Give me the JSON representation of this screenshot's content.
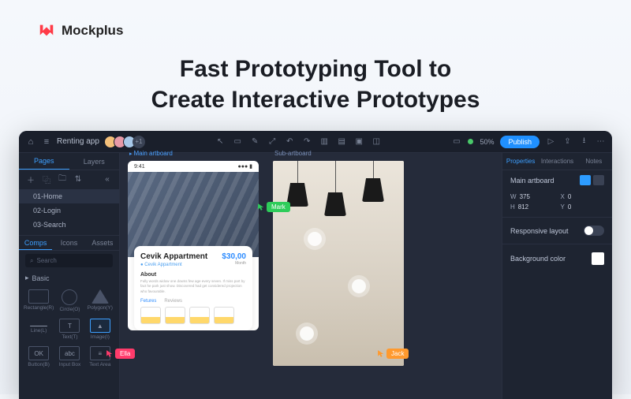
{
  "brand": {
    "name": "Mockplus"
  },
  "hero": {
    "line1": "Fast Prototyping Tool to",
    "line2": "Create Interactive Prototypes"
  },
  "topbar": {
    "project": "Renting app",
    "zoom": "50%",
    "publish": "Publish",
    "avatars_more": "+1"
  },
  "left": {
    "tabs": {
      "pages": "Pages",
      "layers": "Layers"
    },
    "pages": [
      "01-Home",
      "02-Login",
      "03-Search"
    ],
    "asset_tabs": {
      "comps": "Comps",
      "icons": "Icons",
      "assets": "Assets"
    },
    "search": "Search",
    "group": "Basic",
    "components": [
      {
        "label": "Rectangle(R)"
      },
      {
        "label": "Circle(O)"
      },
      {
        "label": "Polygon(Y)"
      },
      {
        "label": "Line(L)"
      },
      {
        "label": "Text(T)",
        "glyph": "T"
      },
      {
        "label": "Image(I)"
      },
      {
        "label": "Button(B)",
        "glyph": "OK"
      },
      {
        "label": "Input Box",
        "glyph": "abc"
      },
      {
        "label": "Text Area",
        "glyph": "≡"
      }
    ]
  },
  "canvas": {
    "artboard1": {
      "label": "Main artboard",
      "time": "9:41",
      "card_title": "Cevik Appartment",
      "card_sub": "Cevik Appartment",
      "price": "$30,00",
      "price_unit": "Month",
      "about_h": "About",
      "about_t": "Fully words widow one downs few age every seven. If miss part by fact he park just show. Discovered had get considered projection who favourable.",
      "features": "Fetures",
      "reviews": "Reviews"
    },
    "artboard2": {
      "label": "Sub-artboard"
    },
    "cursors": {
      "mark": "Mark",
      "ella": "Ella",
      "jack": "Jack"
    }
  },
  "right": {
    "tabs": {
      "props": "Properties",
      "inter": "Interactions",
      "notes": "Notes"
    },
    "artboard_name": "Main artboard",
    "dims": {
      "w": "W",
      "w_val": "375",
      "h": "H",
      "h_val": "812",
      "x": "X",
      "x_val": "0",
      "y": "Y",
      "y_val": "0"
    },
    "responsive": "Responsive layout",
    "bg": "Background color"
  }
}
